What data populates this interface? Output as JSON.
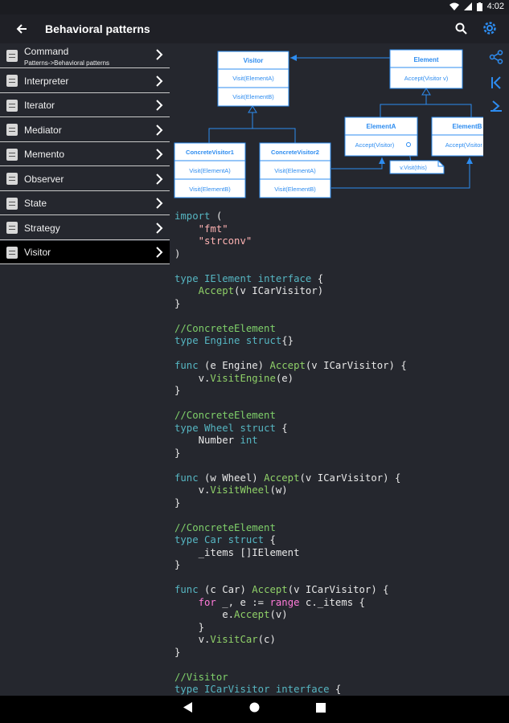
{
  "status": {
    "time": "4:02"
  },
  "appbar": {
    "title": "Behavioral patterns"
  },
  "sidebar": {
    "items": [
      {
        "label": "Command",
        "sub": "Patterns->Behavioral patterns"
      },
      {
        "label": "Interpreter"
      },
      {
        "label": "Iterator"
      },
      {
        "label": "Mediator"
      },
      {
        "label": "Memento"
      },
      {
        "label": "Observer"
      },
      {
        "label": "State"
      },
      {
        "label": "Strategy"
      },
      {
        "label": "Visitor"
      }
    ]
  },
  "diagram": {
    "visitor": {
      "name": "Visitor",
      "m1": "Visit(ElementA)",
      "m2": "Visit(ElementB)"
    },
    "element": {
      "name": "Element",
      "m1": "Accept(Visitor v)"
    },
    "cv1": {
      "name": "ConcreteVisitor1",
      "m1": "Visit(ElementA)",
      "m2": "Visit(ElementB)"
    },
    "cv2": {
      "name": "ConcreteVisitor2",
      "m1": "Visit(ElementA)",
      "m2": "Visit(ElementB)"
    },
    "ea": {
      "name": "ElementA",
      "m1": "Accept(Visitor)"
    },
    "eb": {
      "name": "ElementB",
      "m1": "Accept(Visitor v)"
    },
    "note": "v.Visit(this)"
  }
}
